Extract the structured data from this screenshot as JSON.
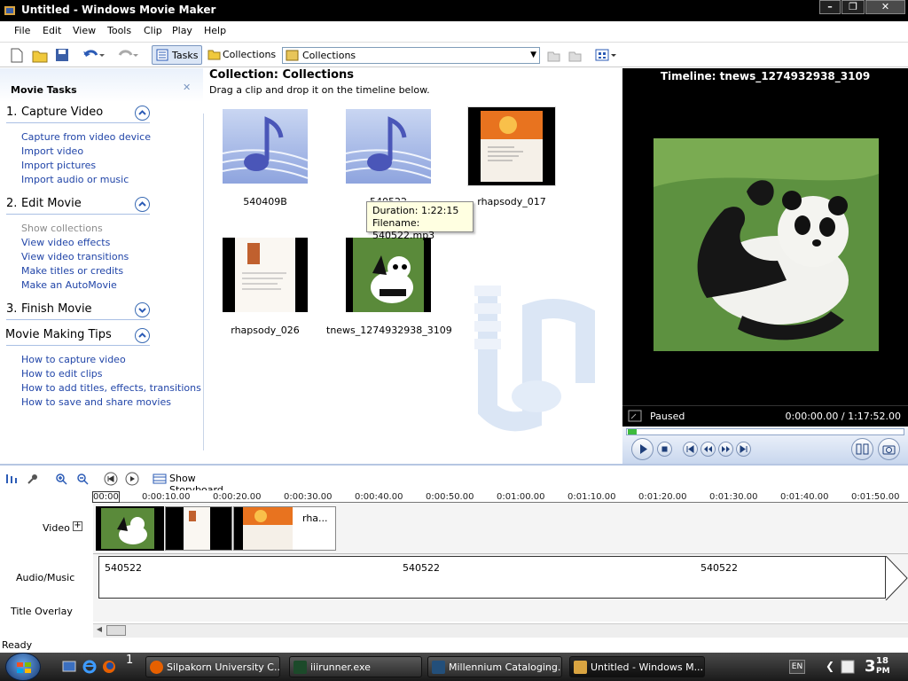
{
  "window": {
    "title": "Untitled - Windows Movie Maker"
  },
  "menu": [
    "File",
    "Edit",
    "View",
    "Tools",
    "Clip",
    "Play",
    "Help"
  ],
  "toolbar": {
    "tasks_label": "Tasks",
    "collections_label": "Collections",
    "collection_select": "Collections"
  },
  "tasks": {
    "header": "Movie Tasks",
    "sections": [
      {
        "num": "1.",
        "title": "Capture Video",
        "links": [
          "Capture from video device",
          "Import video",
          "Import pictures",
          "Import audio or music"
        ]
      },
      {
        "num": "2.",
        "title": "Edit Movie",
        "links": [
          "Show collections",
          "View video effects",
          "View video transitions",
          "Make titles or credits",
          "Make an AutoMovie"
        ]
      },
      {
        "num": "3.",
        "title": "Finish Movie",
        "links": []
      },
      {
        "num": "",
        "title": "Movie Making Tips",
        "links": [
          "How to capture video",
          "How to edit clips",
          "How to add titles, effects, transitions",
          "How to save and share movies"
        ]
      }
    ]
  },
  "collection": {
    "title": "Collection: Collections",
    "subtitle": "Drag a clip and drop it on the timeline below.",
    "items": [
      {
        "name": "540409B",
        "kind": "audio"
      },
      {
        "name": "540522",
        "kind": "audio"
      },
      {
        "name": "rhapsody_017",
        "kind": "image-orange"
      },
      {
        "name": "rhapsody_026",
        "kind": "image-doc"
      },
      {
        "name": "tnews_1274932938_3109",
        "kind": "image-panda"
      }
    ],
    "tooltip": {
      "duration": "Duration:  1:22:15",
      "filename": "Filename: 540522.mp3"
    }
  },
  "preview": {
    "title": "Timeline: tnews_1274932938_3109",
    "state": "Paused",
    "time": "0:00:00.00 / 1:17:52.00"
  },
  "timeline": {
    "show_storyboard": "Show Storyboard",
    "ruler": [
      "00:00",
      "0:00:10.00",
      "0:00:20.00",
      "0:00:30.00",
      "0:00:40.00",
      "0:00:50.00",
      "0:01:00.00",
      "0:01:10.00",
      "0:01:20.00",
      "0:01:30.00",
      "0:01:40.00",
      "0:01:50.00"
    ],
    "labels": {
      "video": "Video",
      "audio": "Audio/Music",
      "title": "Title Overlay"
    },
    "clip_text": "rha...",
    "audio_labels": [
      "540522",
      "540522",
      "540522"
    ]
  },
  "status": "Ready",
  "taskbar": {
    "items": [
      "Silpakorn University C...",
      "iiirunner.exe",
      "Millennium Cataloging...",
      "Untitled - Windows M..."
    ],
    "lang": "EN",
    "clock_hour": "3",
    "clock_min": "18",
    "clock_ampm": "PM",
    "quicklaunch_num": "1"
  }
}
